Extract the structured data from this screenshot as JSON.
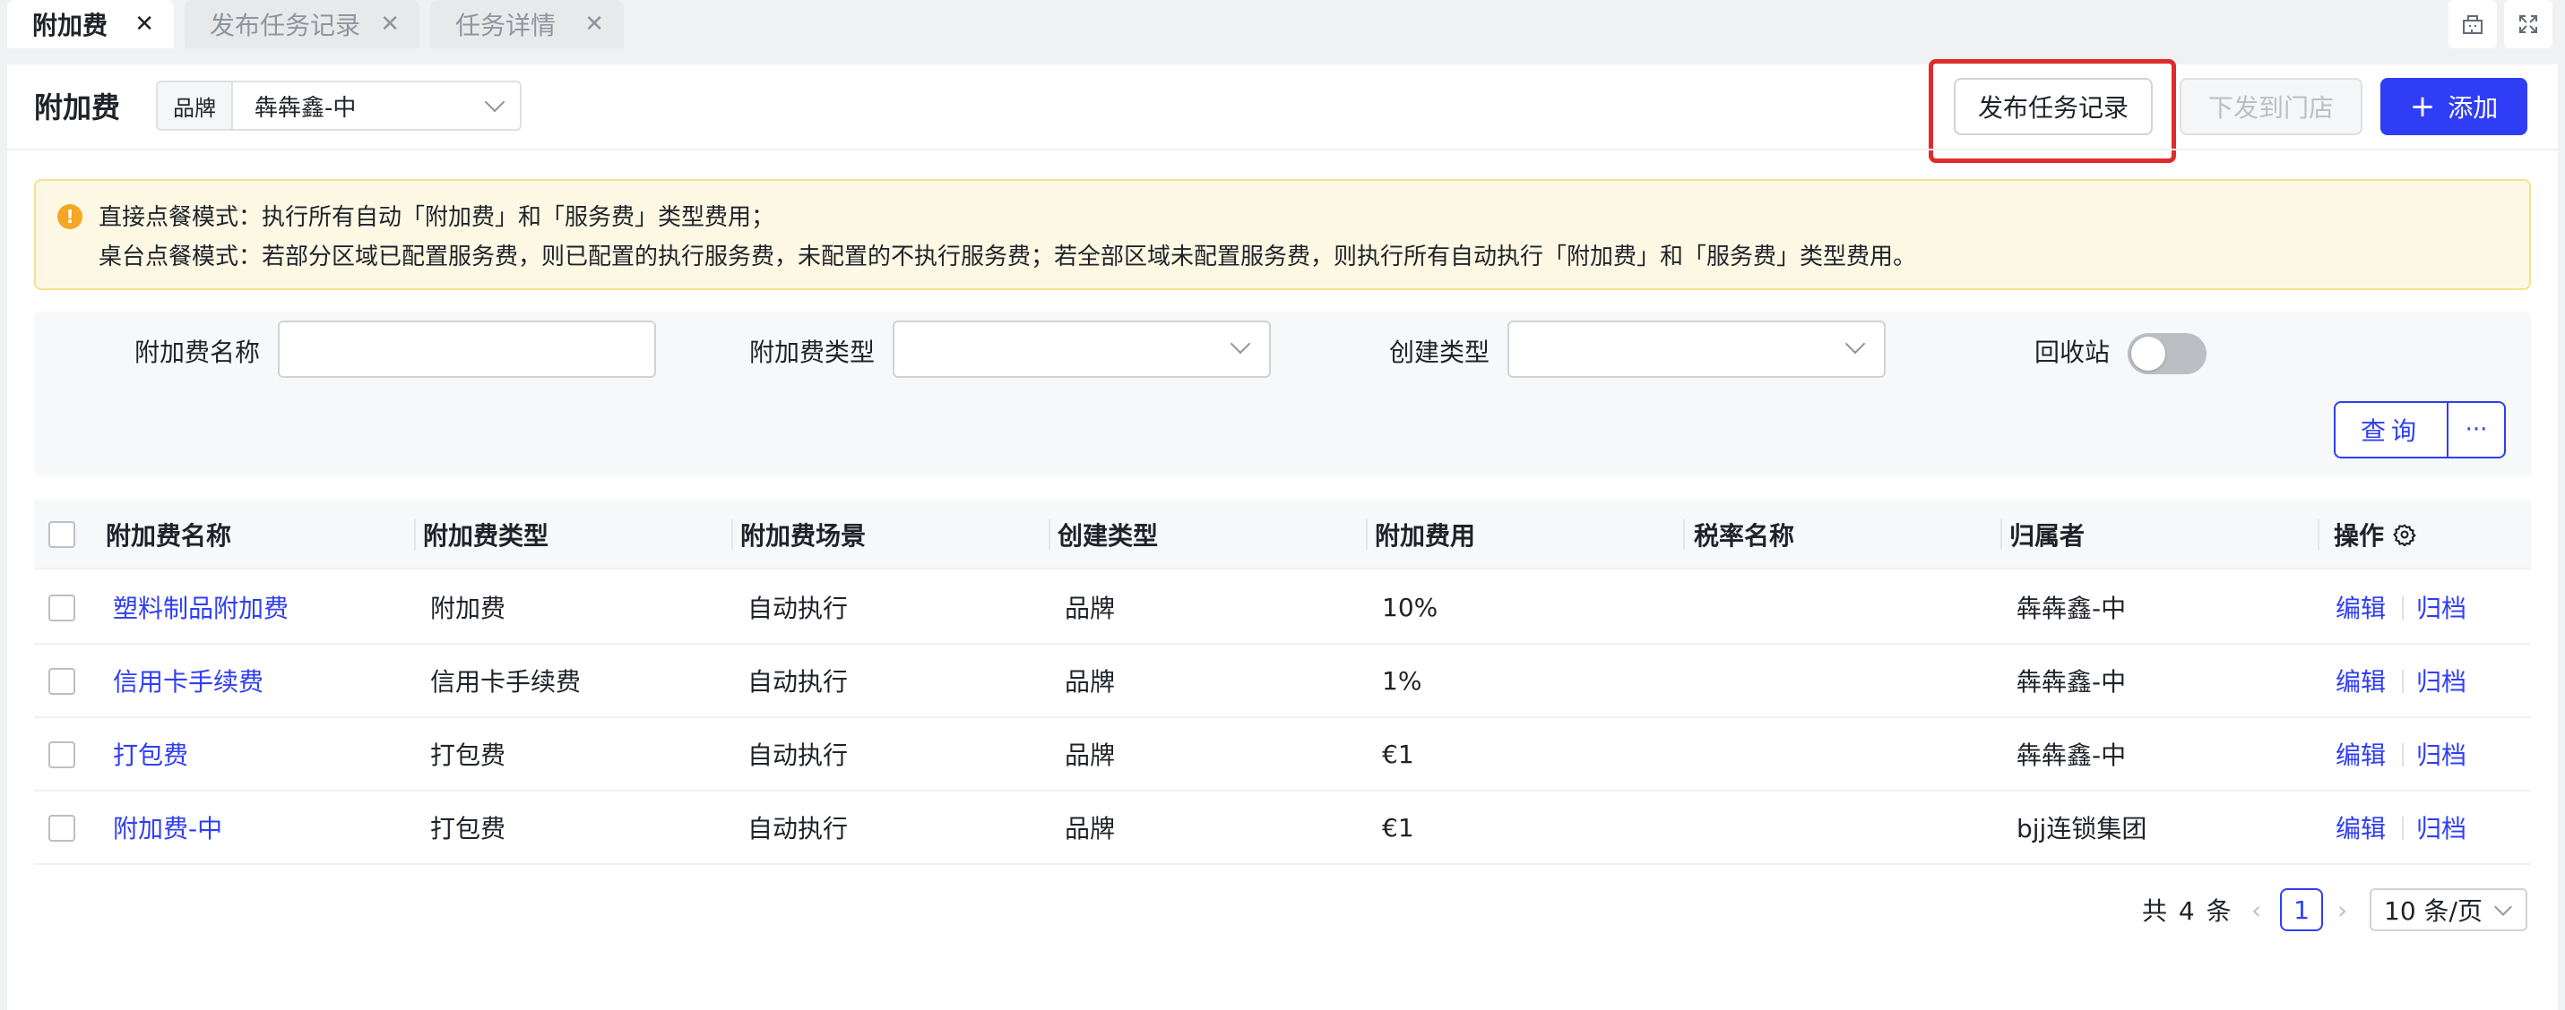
{
  "tabs": [
    {
      "label": "附加费",
      "active": true
    },
    {
      "label": "发布任务记录",
      "active": false
    },
    {
      "label": "任务详情",
      "active": false
    }
  ],
  "page": {
    "title": "附加费",
    "brand_prefix": "品牌",
    "brand_value": "犇犇鑫-中"
  },
  "toolbar": {
    "publish_record_label": "发布任务记录",
    "dispatch_label": "下发到门店",
    "add_label": "添加"
  },
  "alert": {
    "line1": "直接点餐模式：执行所有自动「附加费」和「服务费」类型费用；",
    "line2": "桌台点餐模式：若部分区域已配置服务费，则已配置的执行服务费，未配置的不执行服务费；若全部区域未配置服务费，则执行所有自动执行「附加费」和「服务费」类型费用。"
  },
  "filters": {
    "name_label": "附加费名称",
    "type_label": "附加费类型",
    "create_type_label": "创建类型",
    "recycle_label": "回收站",
    "query_label": "查询",
    "more_label": "···"
  },
  "table": {
    "columns": [
      "附加费名称",
      "附加费类型",
      "附加费场景",
      "创建类型",
      "附加费用",
      "税率名称",
      "归属者",
      "操作"
    ],
    "rows": [
      {
        "name": "塑料制品附加费",
        "type": "附加费",
        "scene": "自动执行",
        "create": "品牌",
        "fee": "10%",
        "tax": "",
        "owner": "犇犇鑫-中"
      },
      {
        "name": "信用卡手续费",
        "type": "信用卡手续费",
        "scene": "自动执行",
        "create": "品牌",
        "fee": "1%",
        "tax": "",
        "owner": "犇犇鑫-中"
      },
      {
        "name": "打包费",
        "type": "打包费",
        "scene": "自动执行",
        "create": "品牌",
        "fee": "€1",
        "tax": "",
        "owner": "犇犇鑫-中"
      },
      {
        "name": "附加费-中",
        "type": "打包费",
        "scene": "自动执行",
        "create": "品牌",
        "fee": "€1",
        "tax": "",
        "owner": "bjj连锁集团"
      }
    ],
    "edit_label": "编辑",
    "archive_label": "归档"
  },
  "pagination": {
    "total_label": "共 4 条",
    "current_page": "1",
    "page_size": "10 条/页"
  },
  "colors": {
    "primary": "#2f3ef5",
    "highlight": "#e02b2b",
    "alert_bg": "#fdf8e4",
    "warning_icon": "#f5a623"
  },
  "icons": [
    "close-icon",
    "chevron-down-icon",
    "plus-icon",
    "warning-icon",
    "gear-icon",
    "chevron-left-icon",
    "chevron-right-icon",
    "building-icon",
    "fullscreen-icon"
  ]
}
